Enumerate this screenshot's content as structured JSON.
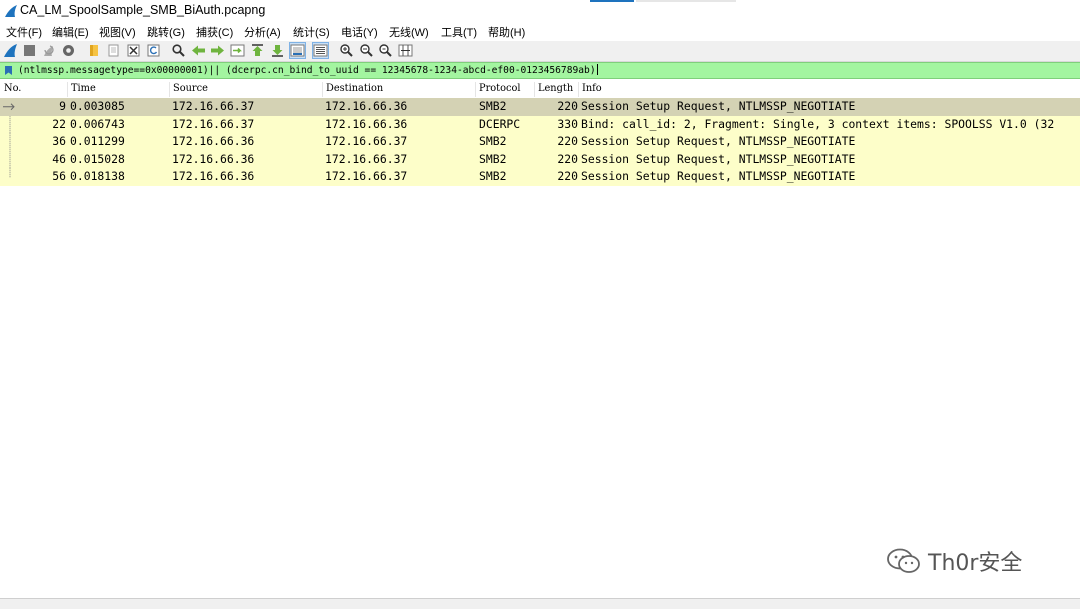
{
  "window": {
    "title": "CA_LM_SpoolSample_SMB_BiAuth.pcapng",
    "accent_color": "#1e73be"
  },
  "menu": [
    "文件(F)",
    "编辑(E)",
    "视图(V)",
    "跳转(G)",
    "捕获(C)",
    "分析(A)",
    "统计(S)",
    "电话(Y)",
    "无线(W)",
    "工具(T)",
    "帮助(H)"
  ],
  "toolbar": {
    "icons": [
      "shark-fin-start-icon",
      "stop-square-icon",
      "restart-capture-icon",
      "capture-options-gear-icon",
      "open-folder-icon",
      "save-file-icon",
      "close-file-icon",
      "reload-icon",
      "find-packet-icon",
      "go-back-arrow-icon",
      "go-forward-arrow-icon",
      "go-to-packet-icon",
      "first-packet-icon",
      "last-packet-icon",
      "auto-scroll-icon",
      "colorize-list-icon",
      "zoom-in-icon",
      "zoom-out-icon",
      "zoom-reset-icon",
      "resize-columns-icon"
    ]
  },
  "filter": {
    "expression": "(ntlmssp.messagetype==0x00000001)|| (dcerpc.cn_bind_to_uuid == 12345678-1234-abcd-ef00-0123456789ab)",
    "valid_color": "#a3f5a0"
  },
  "packet_list": {
    "columns": [
      "No.",
      "Time",
      "Source",
      "Destination",
      "Protocol",
      "Length",
      "Info"
    ],
    "rows": [
      {
        "no": "9",
        "time": "0.003085",
        "source": "172.16.66.37",
        "destination": "172.16.66.36",
        "protocol": "SMB2",
        "length": "220",
        "info": "Session Setup Request, NTLMSSP_NEGOTIATE",
        "selected": true
      },
      {
        "no": "22",
        "time": "0.006743",
        "source": "172.16.66.37",
        "destination": "172.16.66.36",
        "protocol": "DCERPC",
        "length": "330",
        "info": "Bind: call_id: 2, Fragment: Single, 3 context items: SPOOLSS V1.0 (32",
        "selected": false
      },
      {
        "no": "36",
        "time": "0.011299",
        "source": "172.16.66.36",
        "destination": "172.16.66.37",
        "protocol": "SMB2",
        "length": "220",
        "info": "Session Setup Request, NTLMSSP_NEGOTIATE",
        "selected": false
      },
      {
        "no": "46",
        "time": "0.015028",
        "source": "172.16.66.36",
        "destination": "172.16.66.37",
        "protocol": "SMB2",
        "length": "220",
        "info": "Session Setup Request, NTLMSSP_NEGOTIATE",
        "selected": false
      },
      {
        "no": "56",
        "time": "0.018138",
        "source": "172.16.66.36",
        "destination": "172.16.66.37",
        "protocol": "SMB2",
        "length": "220",
        "info": "Session Setup Request, NTLMSSP_NEGOTIATE",
        "selected": false
      }
    ],
    "row_color": "#fdfec9",
    "selected_row_color": "#d4d2b4"
  },
  "watermark": {
    "text": "Th0r安全",
    "icon": "wechat-icon"
  }
}
